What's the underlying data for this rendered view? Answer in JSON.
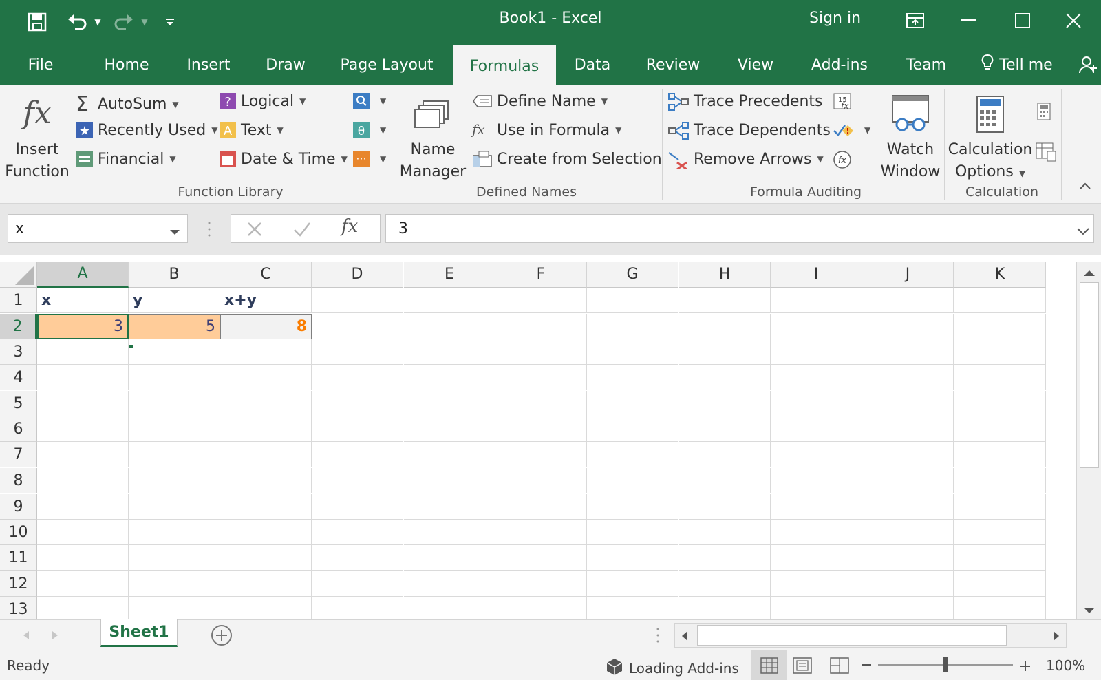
{
  "window": {
    "title": "Book1  -  Excel",
    "sign_in": "Sign in"
  },
  "tabs": [
    {
      "label": "File"
    },
    {
      "label": "Home"
    },
    {
      "label": "Insert"
    },
    {
      "label": "Draw"
    },
    {
      "label": "Page Layout"
    },
    {
      "label": "Formulas"
    },
    {
      "label": "Data"
    },
    {
      "label": "Review"
    },
    {
      "label": "View"
    },
    {
      "label": "Add-ins"
    },
    {
      "label": "Team"
    }
  ],
  "tell_me": "Tell me",
  "ribbon": {
    "insert_function": {
      "line1": "Insert",
      "line2": "Function"
    },
    "function_library": {
      "autosum": "AutoSum",
      "recently_used": "Recently Used",
      "financial": "Financial",
      "logical": "Logical",
      "text": "Text",
      "date_time": "Date & Time",
      "label": "Function Library"
    },
    "defined_names": {
      "name_manager": {
        "line1": "Name",
        "line2": "Manager"
      },
      "define_name": "Define Name",
      "use_in_formula": "Use in Formula",
      "create_from_selection": "Create from Selection",
      "label": "Defined Names"
    },
    "formula_auditing": {
      "trace_precedents": "Trace Precedents",
      "trace_dependents": "Trace Dependents",
      "remove_arrows": "Remove Arrows",
      "label": "Formula Auditing"
    },
    "watch_window": {
      "line1": "Watch",
      "line2": "Window"
    },
    "calculation": {
      "options": {
        "line1": "Calculation",
        "line2": "Options"
      },
      "label": "Calculation"
    }
  },
  "formula_bar": {
    "name_box": "x",
    "formula": "3"
  },
  "columns": [
    "A",
    "B",
    "C",
    "D",
    "E",
    "F",
    "G",
    "H",
    "I",
    "J",
    "K"
  ],
  "rows": [
    "1",
    "2",
    "3",
    "4",
    "5",
    "6",
    "7",
    "8",
    "9",
    "10",
    "11",
    "12",
    "13"
  ],
  "cells": {
    "A1": "x",
    "B1": "y",
    "C1": "x+y",
    "A2": "3",
    "B2": "5",
    "C2": "8"
  },
  "sheets": [
    {
      "label": "Sheet1"
    }
  ],
  "status": {
    "ready": "Ready",
    "loading": "Loading Add-ins",
    "zoom": "100%"
  },
  "colors": {
    "brand": "#217346",
    "input_fill": "#ffcc99",
    "calc_text": "#fa7d00"
  }
}
